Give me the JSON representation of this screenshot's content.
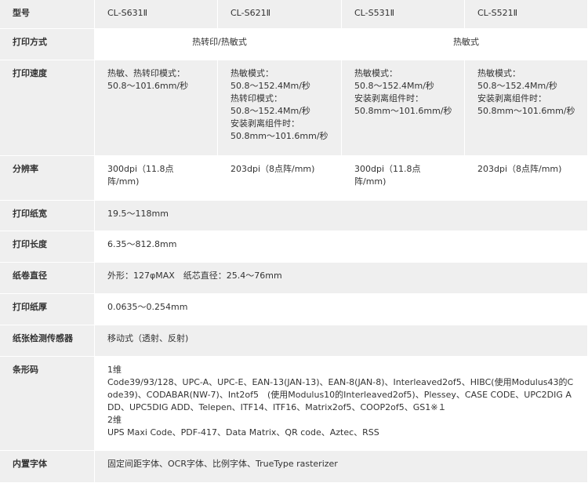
{
  "table": {
    "header": {
      "label": "型号",
      "models": [
        "CL-S631Ⅱ",
        "CL-S621Ⅱ",
        "CL-S531Ⅱ",
        "CL-S521Ⅱ"
      ]
    },
    "print_method": {
      "label": "打印方式",
      "group1": "热转印/热敏式",
      "group2": "热敏式"
    },
    "print_speed": {
      "label": "打印速度",
      "values": [
        "热敏、热转印模式：\n50.8～101.6mm/秒",
        "热敏模式：\n50.8～152.4Mm/秒\n热转印模式：\n50.8～152.4Mm/秒\n安装剥离组件时：\n50.8mm～101.6mm/秒",
        "热敏模式：\n50.8～152.4Mm/秒\n安装剥离组件时：\n50.8mm～101.6mm/秒",
        "热敏模式：\n50.8～152.4Mm/秒\n安装剥离组件时：\n50.8mm～101.6mm/秒"
      ]
    },
    "resolution": {
      "label": "分辨率",
      "values": [
        "300dpi（11.8点\n阵/mm)",
        "203dpi（8点阵/mm)",
        "300dpi（11.8点\n阵/mm)",
        "203dpi（8点阵/mm)"
      ]
    },
    "paper_width": {
      "label": "打印纸宽",
      "value": "19.5～118mm"
    },
    "print_length": {
      "label": "打印长度",
      "value": "6.35～812.8mm"
    },
    "roll_diameter": {
      "label": "纸卷直径",
      "value": "外形：127φMAX　纸芯直径：25.4～76mm"
    },
    "paper_thickness": {
      "label": "打印纸厚",
      "value": "0.0635～0.254mm"
    },
    "paper_sensor": {
      "label": "纸张检测传感器",
      "value": "移动式（透射、反射)"
    },
    "barcode": {
      "label": "条形码",
      "value": "1维\nCode39/93/128、UPC-A、UPC-E、EAN-13(JAN-13)、EAN-8(JAN-8)、Interleaved2of5、HIBC(使用Modulus43的Code39)、CODABAR(NW-7)、Int2of5　(使用Modulus10的Interleaved2of5)、Plessey、CASE CODE、UPC2DIG ADD、UPC5DIG ADD、Telepen、ITF14、ITF16、Matrix2of5、COOP2of5、GS1※１\n2维\nUPS Maxi Code、PDF-417、Data Matrix、QR code、Aztec、RSS"
    },
    "built_in_fonts": {
      "label": "内置字体",
      "value": "固定间距字体、OCR字体、比例字体、TrueType rasterizer"
    }
  }
}
